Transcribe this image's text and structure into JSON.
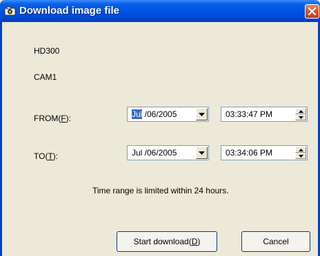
{
  "window": {
    "title": "Download image file",
    "icon": "camera-icon",
    "close_icon": "close-icon"
  },
  "device": {
    "name": "HD300",
    "camera": "CAM1"
  },
  "from": {
    "label_pre": "FROM(",
    "label_key": "F",
    "label_post": "):",
    "date_month": "Jul",
    "date_rest": " /06/2005",
    "time": "03:33:47 PM"
  },
  "to": {
    "label_pre": "TO(",
    "label_key": "T",
    "label_post": "):",
    "date": "Jul /06/2005",
    "time": "03:34:06 PM"
  },
  "note": "Time range is limited within 24 hours.",
  "buttons": {
    "start_pre": "Start download(",
    "start_key": "D",
    "start_post": ")",
    "cancel": "Cancel"
  },
  "colors": {
    "titlebar": "#0054e3",
    "dialog_bg": "#ece9d8",
    "close": "#d9542f",
    "selection": "#316ac5"
  }
}
